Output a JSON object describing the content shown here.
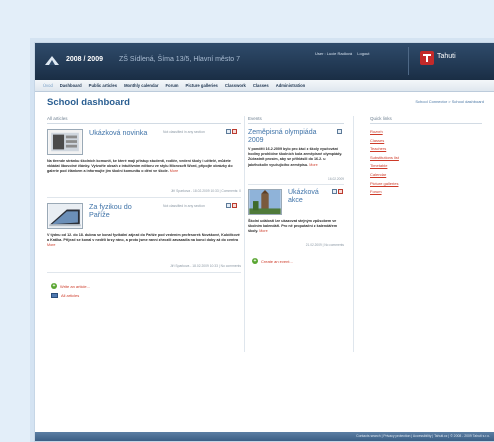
{
  "header": {
    "school_year": "2008 / 2009",
    "school_name": "ZŠ Sídlená, Šíma 13/5, Hlavní město 7",
    "user_label": "User : Lucie Radlová",
    "logout_label": "Logout",
    "brand": "Tahuti"
  },
  "nav": {
    "items": [
      "Úvod",
      "Dashboard",
      "Public articles",
      "Monthly calendar",
      "Forum",
      "Picture galleries",
      "Classwork",
      "Classes",
      "Administration"
    ]
  },
  "page": {
    "title": "School dashboard",
    "breadcrumb": "School Connector > School dashboard"
  },
  "columns": {
    "articles": "All articles",
    "events": "Events",
    "quick_links": "Quick links"
  },
  "articles": [
    {
      "title": "Ukázková novinka",
      "meta": "Not classified in any section",
      "body": "Na tirende stránku školních komunit, ke které mají přístup studenti, rodiče, vedení školy i učitelé, můžete vkládat libovolné články. Vytvořte obsah z intuitivním editoru ve stylu Microsoft Word, připojte obrázky do galerie pod článkem a informujte jím školní komunitu o dění ve škole.",
      "more": "More",
      "footer": "Jiří Sparkova - 18.02.2009 10:33 | Comments: 0"
    },
    {
      "title": "Za fyzikou do Paříže",
      "meta": "Not classified in any section",
      "body": "V týdnu od 12. do 18. dubna se konal fyzikální zájezd do Paříže pod vedením profesorek Novákové, Kubíčkové a Králka. Přijezd se konal v nedělí brzy ráno, a proto jsme ranní zhrozili zavazadla na konci doby až do centra",
      "more": "More",
      "footer": "Jiří Sparkova - 18.02.2009 10:33 | No comments"
    }
  ],
  "article_actions": {
    "write": "Write an article...",
    "all": "All articles"
  },
  "events": [
    {
      "title": "Zeměpisná olympiáda 2009",
      "body": "V pondělí 16.2.2009 bylo pro žáci z školy vyučování hodiny prohlídne školních kola zeměpisné olympiády. Zúčastnit prosím, aby se přihlásili do 16.2. u jakéhokoliv vyučujícího zeměpisu.",
      "more": "More",
      "date": "16.02.2009"
    },
    {
      "title": "Ukázková akce",
      "body": "Školní události lze ukazovat stejným způsobem ve školním kalendáři. Pro ně proputační z kalendářem školy.",
      "more": "More",
      "date": "21.02.2009 | No comments"
    }
  ],
  "event_actions": {
    "create": "Create an event..."
  },
  "quick_links": [
    "Rozvrh",
    "Classes",
    "Teachers",
    "Substitutions list",
    "Timetable",
    "Calendar",
    "Picture galleries",
    "Forum"
  ],
  "footer": {
    "text": "Contacts search | Privacy protection | Accessibility | Tahuti.cz | © 2008 - 2009 Tahuti s.r.o."
  }
}
